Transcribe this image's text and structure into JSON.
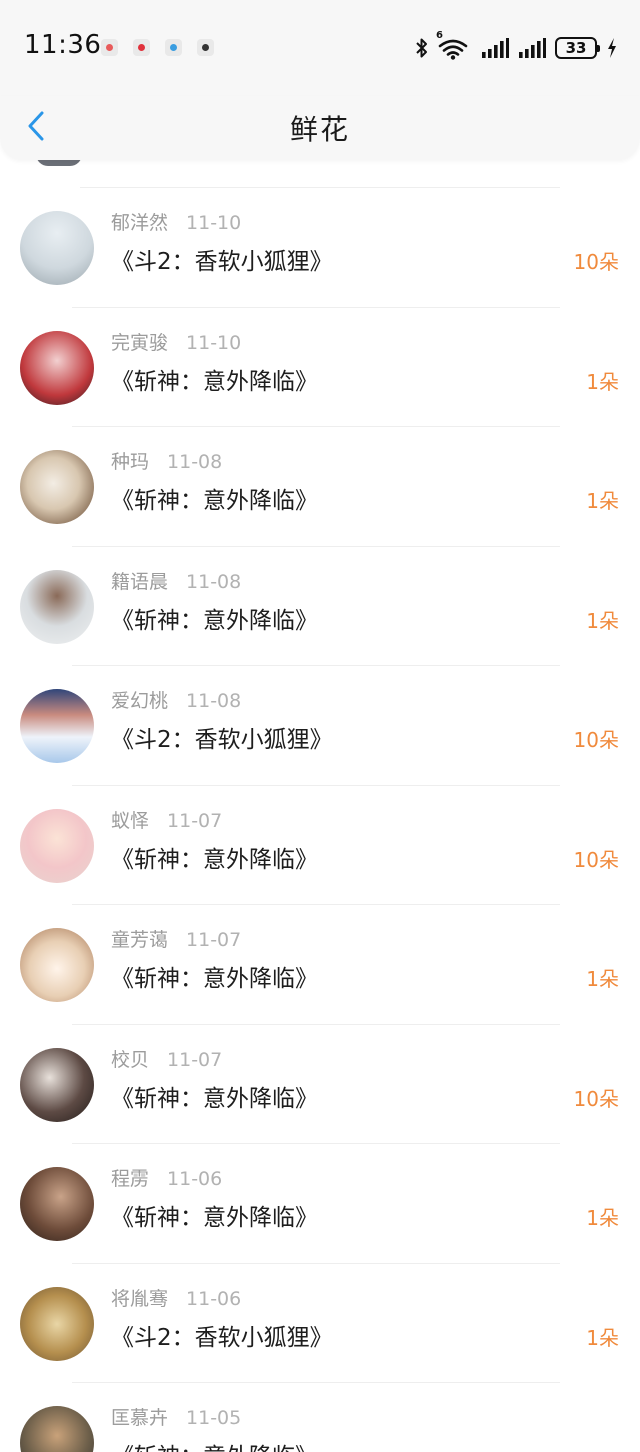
{
  "status_bar": {
    "time": "11:36",
    "notification_icons": [
      "#e85a5a",
      "#e0323c",
      "#3a9de0",
      "#333333"
    ],
    "wifi_badge": "6",
    "battery": "33"
  },
  "header": {
    "title": "鲜花"
  },
  "colors": {
    "accent_blue": "#2a96e8",
    "count_orange": "#f08a3c"
  },
  "rows": [
    {
      "name": "郁洋然",
      "date": "11-10",
      "book": "《斗2：香软小狐狸》",
      "count": "10朵"
    },
    {
      "name": "完寅骏",
      "date": "11-10",
      "book": "《斩神：意外降临》",
      "count": "1朵"
    },
    {
      "name": "种玛",
      "date": "11-08",
      "book": "《斩神：意外降临》",
      "count": "1朵"
    },
    {
      "name": "籍语晨",
      "date": "11-08",
      "book": "《斩神：意外降临》",
      "count": "1朵"
    },
    {
      "name": "爱幻桃",
      "date": "11-08",
      "book": "《斗2：香软小狐狸》",
      "count": "10朵"
    },
    {
      "name": "蚁怿",
      "date": "11-07",
      "book": "《斩神：意外降临》",
      "count": "10朵"
    },
    {
      "name": "童芳蔼",
      "date": "11-07",
      "book": "《斩神：意外降临》",
      "count": "1朵"
    },
    {
      "name": "校贝",
      "date": "11-07",
      "book": "《斩神：意外降临》",
      "count": "10朵"
    },
    {
      "name": "程雳",
      "date": "11-06",
      "book": "《斩神：意外降临》",
      "count": "1朵"
    },
    {
      "name": "将胤骞",
      "date": "11-06",
      "book": "《斗2：香软小狐狸》",
      "count": "1朵"
    },
    {
      "name": "匡慕卉",
      "date": "11-05",
      "book": "《斩神：意外降临》",
      "count": ""
    }
  ]
}
